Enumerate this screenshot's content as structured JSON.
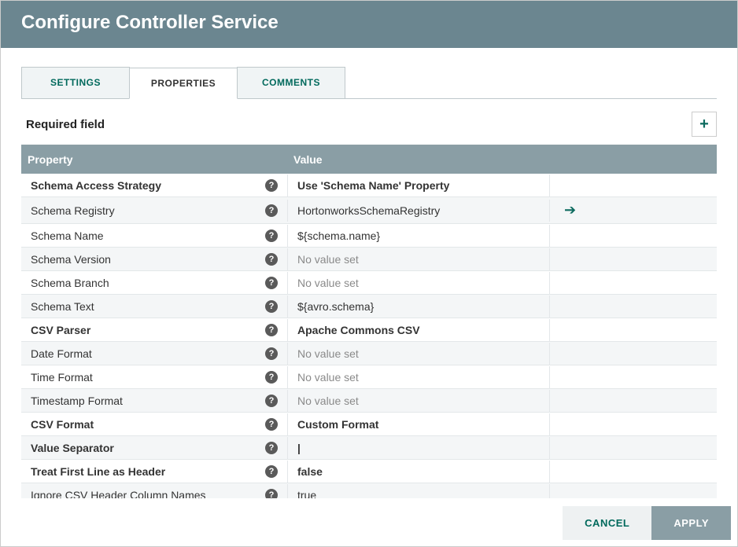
{
  "header": {
    "title": "Configure Controller Service"
  },
  "tabs": {
    "settings": {
      "label": "SETTINGS",
      "active": false
    },
    "properties": {
      "label": "PROPERTIES",
      "active": true
    },
    "comments": {
      "label": "COMMENTS",
      "active": false
    }
  },
  "required_label": "Required field",
  "columns": {
    "property": "Property",
    "value": "Value"
  },
  "rows": [
    {
      "name": "Schema Access Strategy",
      "bold": true,
      "value": "Use 'Schema Name' Property",
      "vbold": true,
      "placeholder": false,
      "goto": false
    },
    {
      "name": "Schema Registry",
      "bold": false,
      "value": "HortonworksSchemaRegistry",
      "vbold": false,
      "placeholder": false,
      "goto": true
    },
    {
      "name": "Schema Name",
      "bold": false,
      "value": "${schema.name}",
      "vbold": false,
      "placeholder": false,
      "goto": false
    },
    {
      "name": "Schema Version",
      "bold": false,
      "value": "No value set",
      "vbold": false,
      "placeholder": true,
      "goto": false
    },
    {
      "name": "Schema Branch",
      "bold": false,
      "value": "No value set",
      "vbold": false,
      "placeholder": true,
      "goto": false
    },
    {
      "name": "Schema Text",
      "bold": false,
      "value": "${avro.schema}",
      "vbold": false,
      "placeholder": false,
      "goto": false
    },
    {
      "name": "CSV Parser",
      "bold": true,
      "value": "Apache Commons CSV",
      "vbold": true,
      "placeholder": false,
      "goto": false
    },
    {
      "name": "Date Format",
      "bold": false,
      "value": "No value set",
      "vbold": false,
      "placeholder": true,
      "goto": false
    },
    {
      "name": "Time Format",
      "bold": false,
      "value": "No value set",
      "vbold": false,
      "placeholder": true,
      "goto": false
    },
    {
      "name": "Timestamp Format",
      "bold": false,
      "value": "No value set",
      "vbold": false,
      "placeholder": true,
      "goto": false
    },
    {
      "name": "CSV Format",
      "bold": true,
      "value": "Custom Format",
      "vbold": true,
      "placeholder": false,
      "goto": false
    },
    {
      "name": "Value Separator",
      "bold": true,
      "value": "|",
      "vbold": true,
      "placeholder": false,
      "goto": false
    },
    {
      "name": "Treat First Line as Header",
      "bold": true,
      "value": "false",
      "vbold": true,
      "placeholder": false,
      "goto": false
    },
    {
      "name": "Ignore CSV Header Column Names",
      "bold": false,
      "value": "true",
      "vbold": false,
      "placeholder": false,
      "goto": false
    }
  ],
  "footer": {
    "cancel": "CANCEL",
    "apply": "APPLY"
  },
  "icons": {
    "help": "?",
    "add": "+",
    "goto": "➔"
  }
}
